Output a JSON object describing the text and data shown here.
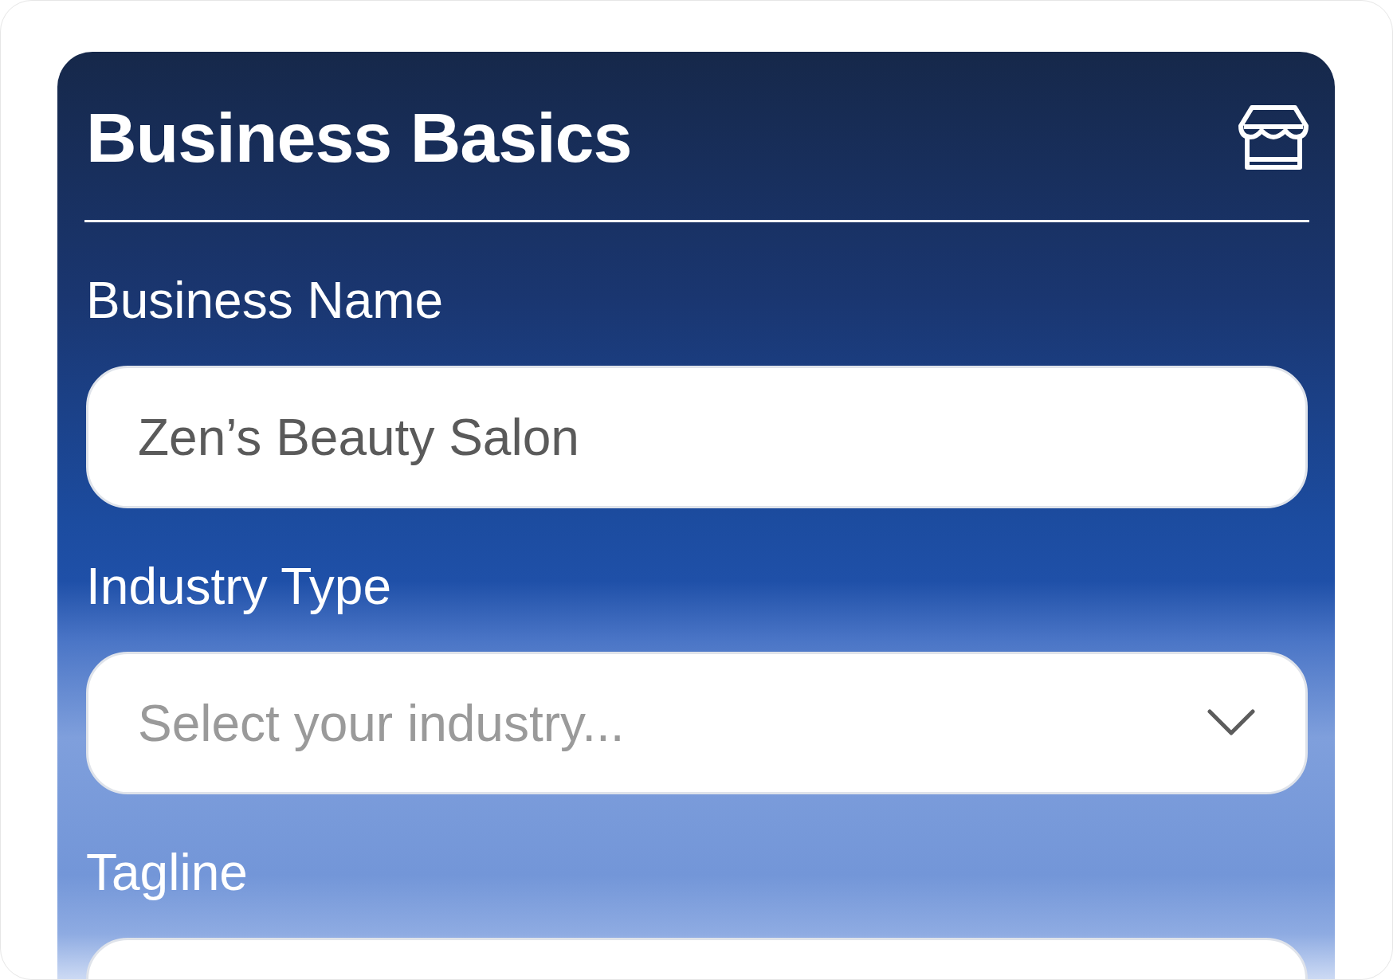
{
  "card": {
    "title": "Business Basics",
    "fields": [
      {
        "label": "Business Name",
        "kind": "text",
        "value": "Zen’s Beauty Salon"
      },
      {
        "label": "Industry Type",
        "kind": "select",
        "placeholder": "Select your industry..."
      },
      {
        "label": "Tagline",
        "kind": "text"
      }
    ]
  }
}
